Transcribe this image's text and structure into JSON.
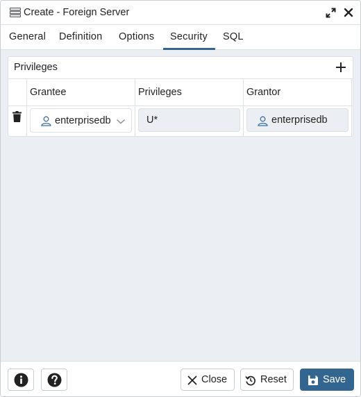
{
  "dialog": {
    "title": "Create - Foreign Server",
    "icons": {
      "title": "server-icon",
      "expand": "expand-icon",
      "close": "close-icon"
    }
  },
  "tabs": [
    {
      "label": "General",
      "active": false
    },
    {
      "label": "Definition",
      "active": false
    },
    {
      "label": "Options",
      "active": false
    },
    {
      "label": "Security",
      "active": true
    },
    {
      "label": "SQL",
      "active": false
    }
  ],
  "privileges": {
    "title": "Privileges",
    "columns": [
      "Grantee",
      "Privileges",
      "Grantor"
    ],
    "rows": [
      {
        "grantee": "enterprisedb",
        "privileges": "U*",
        "grantor": "enterprisedb"
      }
    ]
  },
  "footer": {
    "close_label": "Close",
    "reset_label": "Reset",
    "save_label": "Save"
  },
  "colors": {
    "accent": "#326690",
    "border": "#dde0e6",
    "background": "#ebeef3",
    "user_icon": "#3a70a8"
  }
}
